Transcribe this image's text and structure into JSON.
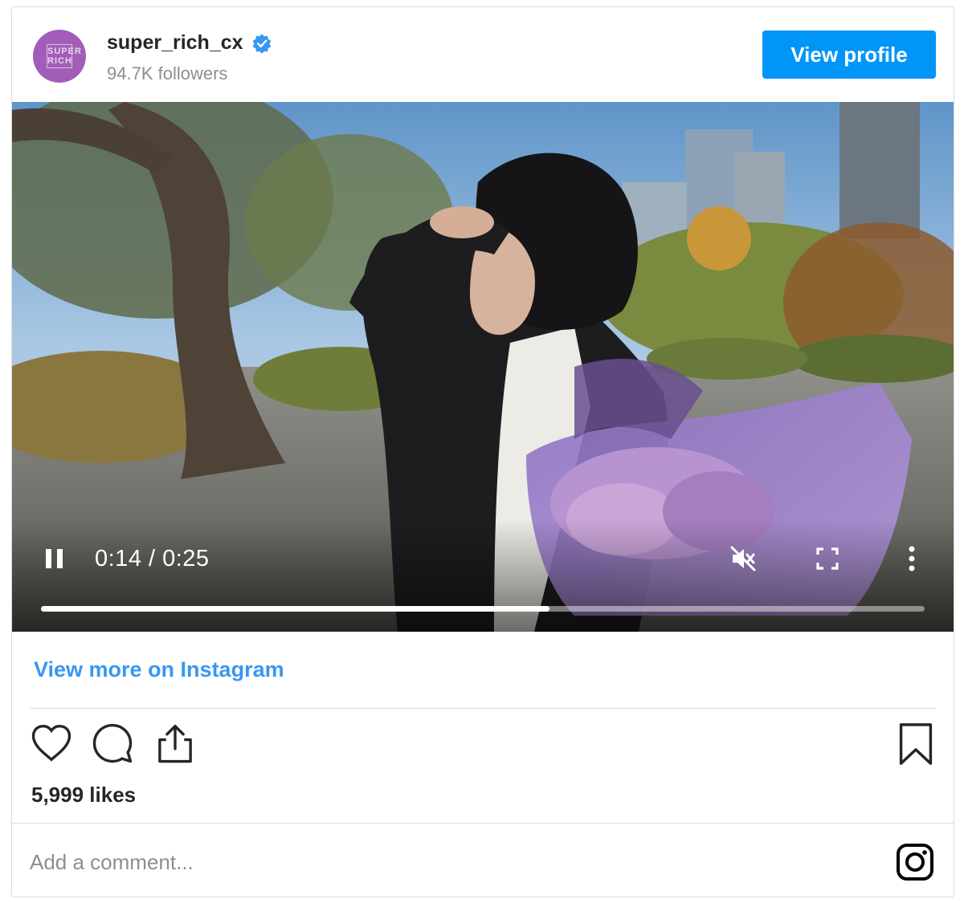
{
  "header": {
    "avatar_text": "SUPER RICH",
    "username": "super_rich_cx",
    "verified": true,
    "followers": "94.7K followers",
    "view_profile_label": "View profile"
  },
  "video": {
    "time_display": "0:14 / 0:25",
    "progress_fraction": 0.575,
    "muted": true
  },
  "links": {
    "view_more": "View more on Instagram"
  },
  "engagement": {
    "likes": "5,999 likes"
  },
  "comment": {
    "placeholder": "Add a comment..."
  },
  "icons": {
    "like": "heart-icon",
    "comment": "comment-bubble-icon",
    "share": "share-icon",
    "save": "bookmark-icon",
    "instagram": "instagram-logo-icon",
    "verified": "verified-badge-icon",
    "pause": "pause-icon",
    "mute": "volume-muted-icon",
    "fullscreen": "fullscreen-icon",
    "more": "more-vertical-icon"
  },
  "colors": {
    "primary_button": "#0095f6",
    "link": "#3897f0",
    "verified": "#3897f0",
    "avatar": "#a35db8"
  }
}
